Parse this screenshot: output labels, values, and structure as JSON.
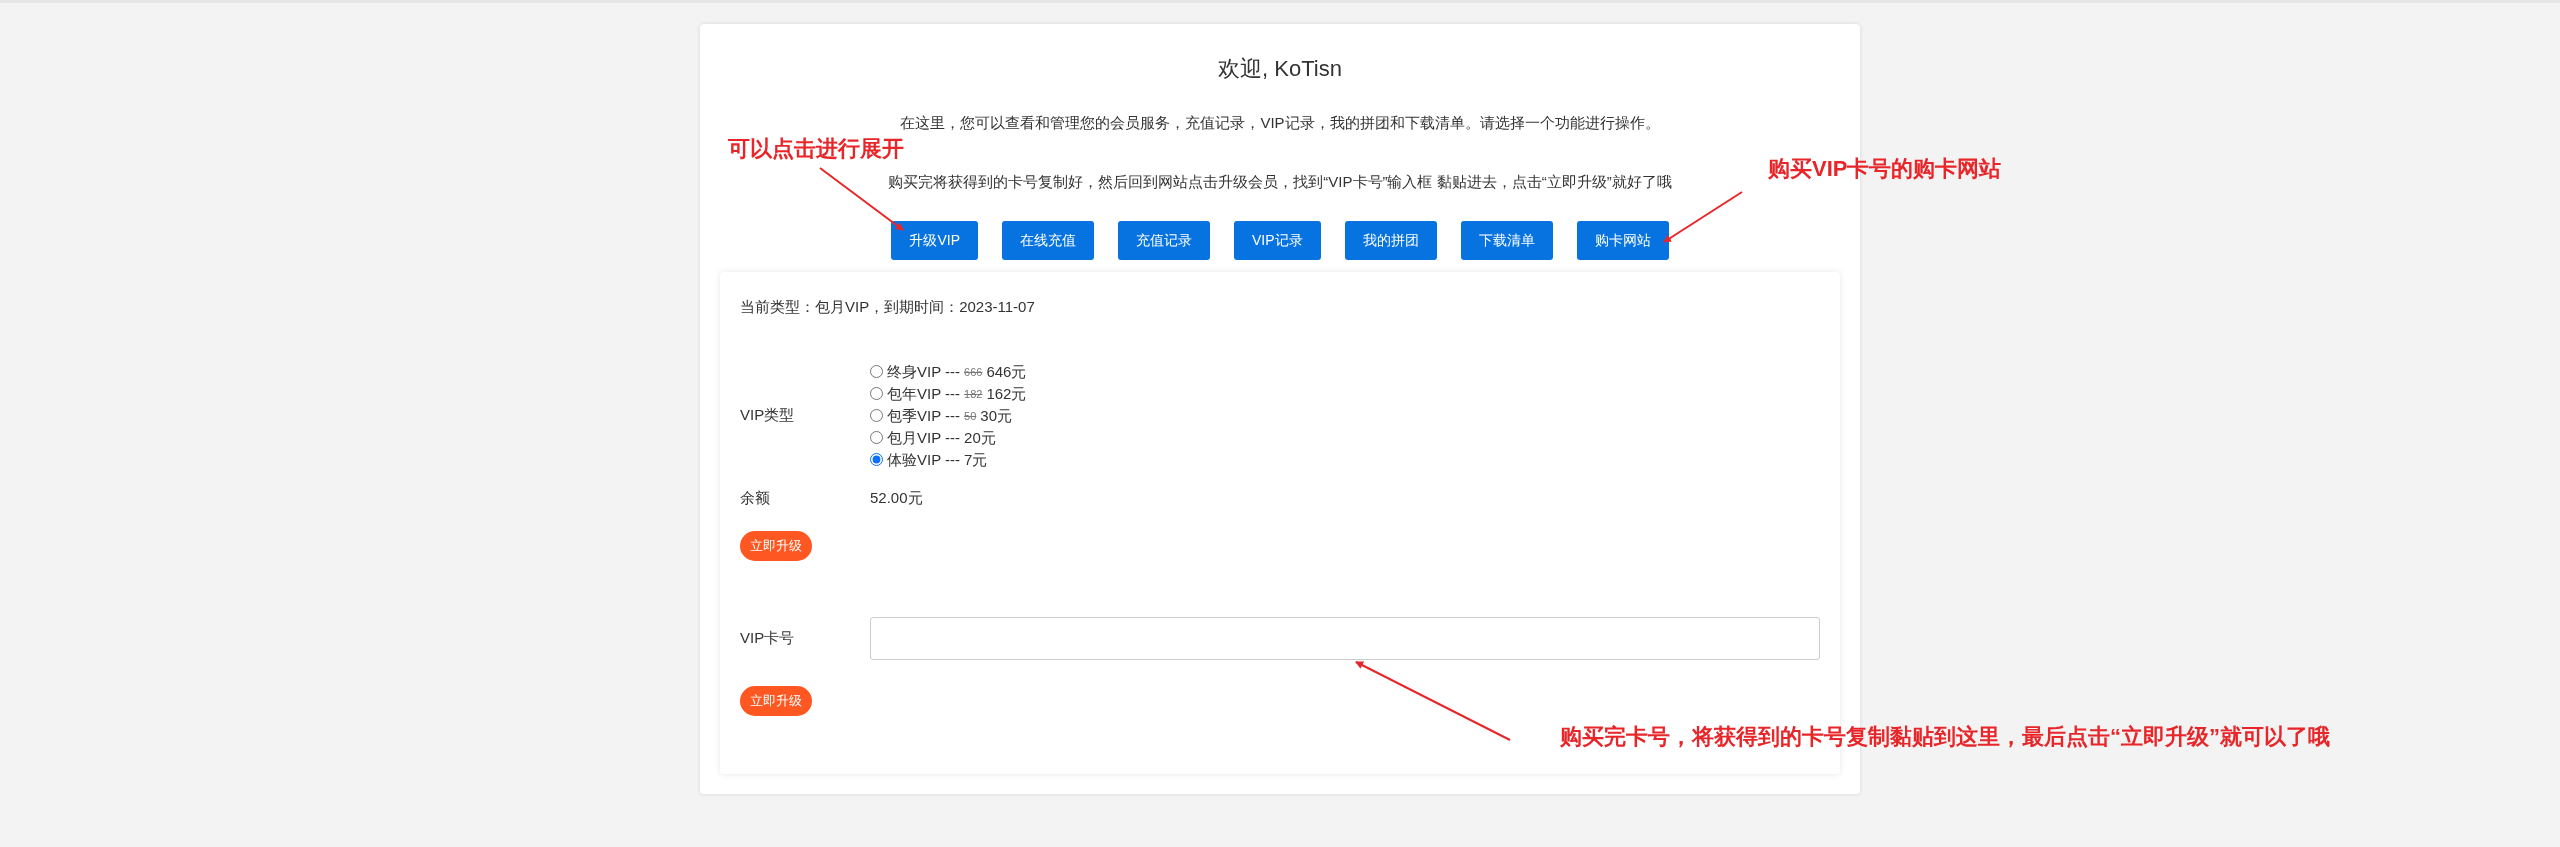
{
  "header": {
    "title": "欢迎, KoTisn",
    "intro": "在这里，您可以查看和管理您的会员服务，充值记录，VIP记录，我的拼团和下载清单。请选择一个功能进行操作。",
    "instructions": "购买完将获得到的卡号复制好，然后回到网站点击升级会员，找到“VIP卡号”输入框 黏贴进去，点击“立即升级”就好了哦"
  },
  "nav_buttons": [
    "升级VIP",
    "在线充值",
    "充值记录",
    "VIP记录",
    "我的拼团",
    "下载清单",
    "购卡网站"
  ],
  "status": "当前类型：包月VIP，到期时间：2023-11-07",
  "vip_type": {
    "label": "VIP类型",
    "options": [
      {
        "name": "终身VIP ---",
        "old_price": "666",
        "price": "646元",
        "selected": false
      },
      {
        "name": "包年VIP ---",
        "old_price": "182",
        "price": "162元",
        "selected": false
      },
      {
        "name": "包季VIP ---",
        "old_price": "50",
        "price": "30元",
        "selected": false
      },
      {
        "name": "包月VIP ---",
        "price": "20元",
        "selected": false
      },
      {
        "name": "体验VIP ---",
        "price": "7元",
        "selected": true
      }
    ]
  },
  "balance": {
    "label": "余额",
    "value": "52.00元"
  },
  "upgrade_button": "立即升级",
  "card_field": {
    "label": "VIP卡号"
  },
  "card_upgrade_button": "立即升级",
  "annotations": [
    {
      "text": "可以点击进行展开",
      "kind": "left"
    },
    {
      "text": "购买VIP卡号的购卡网站",
      "kind": "right"
    },
    {
      "text": "购买完卡号，将获得到的卡号复制黏贴到这里，最后点击“立即升级”就可以了哦",
      "kind": "bottom"
    }
  ]
}
